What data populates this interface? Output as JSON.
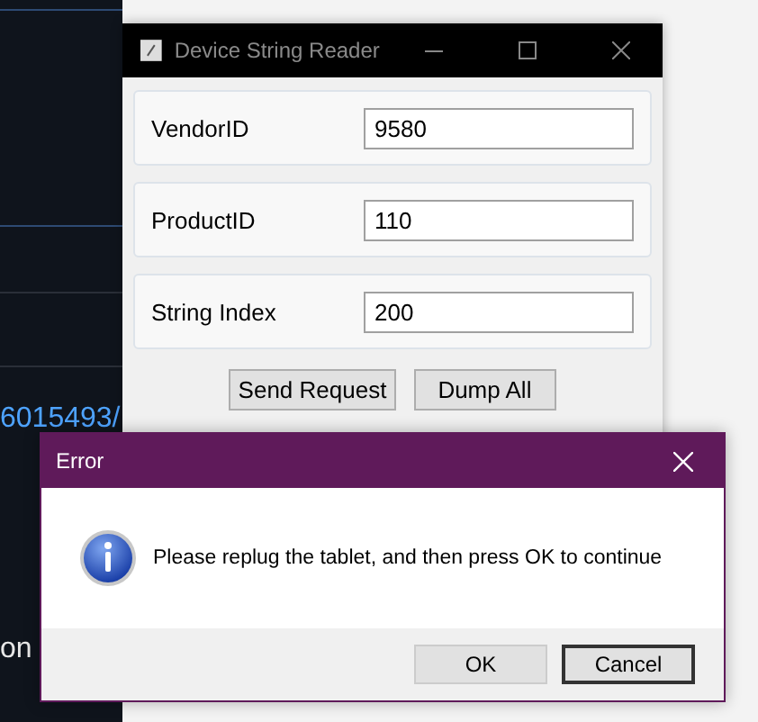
{
  "background": {
    "texts": [
      {
        "text": "6015493/",
        "kind": "link"
      },
      {
        "text": "on",
        "kind": "plain"
      }
    ]
  },
  "window": {
    "title": "Device String Reader",
    "fields": [
      {
        "label": "VendorID",
        "value": "9580"
      },
      {
        "label": "ProductID",
        "value": "110"
      },
      {
        "label": "String Index",
        "value": "200"
      }
    ],
    "buttons": [
      "Send Request",
      "Dump All"
    ]
  },
  "dialog": {
    "title": "Error",
    "message": "Please replug the tablet, and then press OK to continue",
    "buttons": [
      {
        "label": "OK",
        "default": false
      },
      {
        "label": "Cancel",
        "default": true
      }
    ]
  }
}
